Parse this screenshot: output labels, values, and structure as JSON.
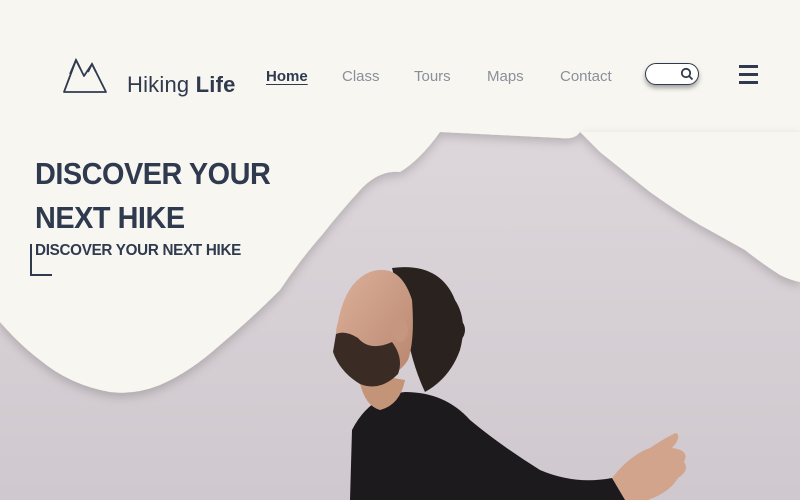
{
  "brand": {
    "name_light": "Hiking",
    "name_bold": "Life",
    "logo_icon": "mountain-icon"
  },
  "nav": {
    "items": [
      {
        "label": "Home",
        "active": true
      },
      {
        "label": "Class",
        "active": false
      },
      {
        "label": "Tours",
        "active": false
      },
      {
        "label": "Maps",
        "active": false
      },
      {
        "label": "Contact",
        "active": false
      }
    ]
  },
  "search": {
    "icon": "search-icon"
  },
  "menu": {
    "icon": "hamburger-menu-icon"
  },
  "hero": {
    "title": "DISCOVER YOUR NEXT HIKE",
    "subtitle": "DISCOVER YOUR NEXT HIKE",
    "image": "man-with-open-arms-photo"
  },
  "colors": {
    "paper": "#f6f5ef",
    "navy": "#2f3a4f",
    "nav_muted": "#8a8f99",
    "sky": "#d9d3d8"
  }
}
